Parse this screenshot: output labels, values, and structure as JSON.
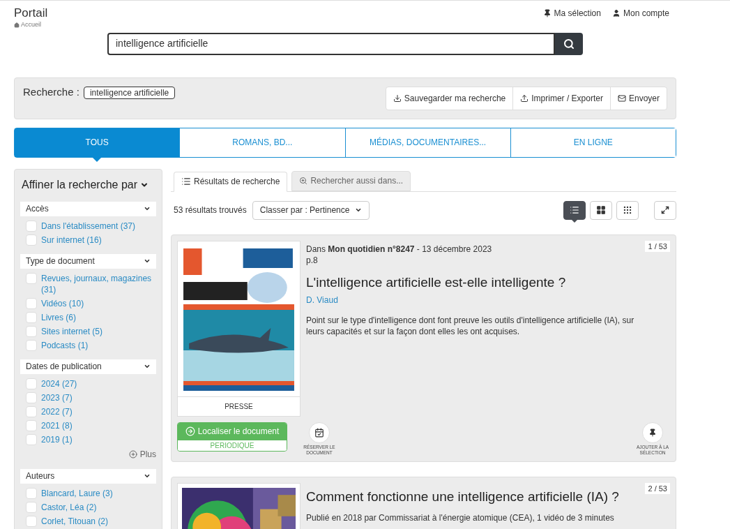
{
  "header": {
    "title": "Portail",
    "breadcrumb": "Accueil",
    "links": [
      {
        "kind": "pin",
        "label": "Ma sélection"
      },
      {
        "kind": "user",
        "label": "Mon compte"
      }
    ]
  },
  "search": {
    "value": "intelligence artificielle"
  },
  "query_bar": {
    "label": "Recherche :",
    "term": "intelligence artificielle",
    "actions": [
      {
        "kind": "download",
        "label": "Sauvegarder ma recherche"
      },
      {
        "kind": "upload",
        "label": "Imprimer / Exporter"
      },
      {
        "kind": "mail",
        "label": "Envoyer"
      }
    ]
  },
  "category_tabs": [
    {
      "label": "TOUS",
      "selected": true
    },
    {
      "label": "ROMANS, BD...",
      "selected": false
    },
    {
      "label": "MÉDIAS, DOCUMENTAIRES...",
      "selected": false
    },
    {
      "label": "EN LIGNE",
      "selected": false
    }
  ],
  "sidebar": {
    "title": "Affiner la recherche par",
    "facets": [
      {
        "title": "Accès",
        "options": [
          {
            "label": "Dans l'établissement (37)",
            "checked": false
          },
          {
            "label": "Sur internet (16)",
            "checked": false
          }
        ]
      },
      {
        "title": "Type de document",
        "options": [
          {
            "label": "Revues, journaux, magazines (31)",
            "checked": false
          },
          {
            "label": "Vidéos (10)",
            "checked": false
          },
          {
            "label": "Livres (6)",
            "checked": false
          },
          {
            "label": "Sites internet (5)",
            "checked": false
          },
          {
            "label": "Podcasts (1)",
            "checked": false
          }
        ]
      },
      {
        "title": "Dates de publication",
        "options": [
          {
            "label": "2024 (27)",
            "checked": false
          },
          {
            "label": "2023 (7)",
            "checked": false
          },
          {
            "label": "2022 (7)",
            "checked": false
          },
          {
            "label": "2021 (8)",
            "checked": false
          },
          {
            "label": "2019 (1)",
            "checked": false
          }
        ],
        "more": "Plus"
      },
      {
        "title": "Auteurs",
        "options": [
          {
            "label": "Blancard, Laure (3)",
            "checked": false
          },
          {
            "label": "Castor, Léa (2)",
            "checked": false
          },
          {
            "label": "Corlet, Titouan (2)",
            "checked": false
          }
        ]
      }
    ]
  },
  "result_tabs": [
    {
      "kind": "list",
      "label": "Résultats de recherche",
      "selected": true
    },
    {
      "kind": "search",
      "label": "Rechercher aussi dans...",
      "selected": false
    }
  ],
  "toolbar": {
    "count": "53 résultats trouvés",
    "sort": "Classer par : Pertinence",
    "views": [
      {
        "kind": "list",
        "selected": true
      },
      {
        "kind": "grid",
        "selected": false
      },
      {
        "kind": "grid-small",
        "selected": false
      }
    ]
  },
  "results": [
    {
      "counter": "1 / 53",
      "source": "Dans **Mon quotidien n°8247** - 13 décembre 2023",
      "page": "p.8",
      "title": "L'intelligence artificielle est-elle intelligente ?",
      "author": "D. Viaud",
      "summary": "Point sur le type d'intelligence dont font preuve les outils d'intelligence artificielle (IA), sur leurs capacités et sur la façon dont elles les ont acquises.",
      "cover": {
        "kind": "magazine"
      },
      "doc_type": "PRESSE",
      "locate": {
        "label": "Localiser le document",
        "sub": "PERIODIQUE"
      },
      "actions": [
        {
          "kind": "reserve",
          "label": "RÉSERVER LE DOCUMENT"
        },
        {
          "kind": "pin",
          "label": "AJOUTER À LA SÉLECTION"
        }
      ]
    },
    {
      "counter": "2 / 53",
      "title": "Comment fonctionne une intelligence artificielle (IA) ?",
      "summary": "Publié en 2018 par Commissariat à l'énergie atomique (CEA), 1 vidéo de 3 minutes",
      "cover": {
        "kind": "circuit"
      }
    }
  ]
}
